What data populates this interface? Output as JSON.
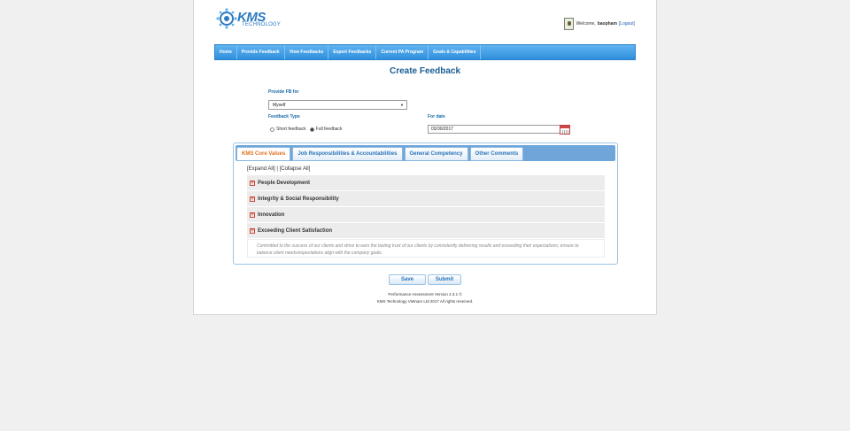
{
  "logo": {
    "brand": "KMS",
    "sub": "TECHNOLOGY"
  },
  "user": {
    "welcome": "Welcome,",
    "name": "baopham",
    "logout": "[Logout]"
  },
  "nav": [
    "Home",
    "Provide Feedback",
    "View Feedbacks",
    "Export Feedbacks",
    "Current PA Program",
    "Goals & Capabilities"
  ],
  "title": "Create Feedback",
  "form": {
    "provide_for_label": "Provide FB for",
    "provide_for_value": "Myself",
    "type_label": "Feedback Type",
    "short_label": "Short feedback",
    "full_label": "Full feedback",
    "selected_type": "full",
    "date_label": "For date",
    "date_value": "03/30/2017"
  },
  "tabs": [
    "KMS Core Values",
    "Job Responsibilities & Accountabilities",
    "General Competency",
    "Other Comments"
  ],
  "active_tab": "KMS Core Values",
  "expand": {
    "expand_all": "[Expand All]",
    "sep": "|",
    "collapse_all": "[Collapse All]"
  },
  "groups": [
    "People Development",
    "Integrity & Social Responsibility",
    "Innovation",
    "Exceeding Client Satisfaction"
  ],
  "group_desc": "Committed to the success of our clients and strive to earn the lasting trust of our clients by consistently delivering results and exceeding their expectations; ensure to balance client needs/expectations align with the company goals.",
  "buttons": {
    "save": "Save",
    "submit": "Submit"
  },
  "footer": {
    "line1": "Performance Assessment Version 4.3.1 ©",
    "line2": "KMS Technology Vietnam Ltd 2017 All rights reserved."
  },
  "colors": {
    "nav": "#2f8fdd",
    "title": "#1a5e94",
    "active_tab": "#e07020"
  }
}
